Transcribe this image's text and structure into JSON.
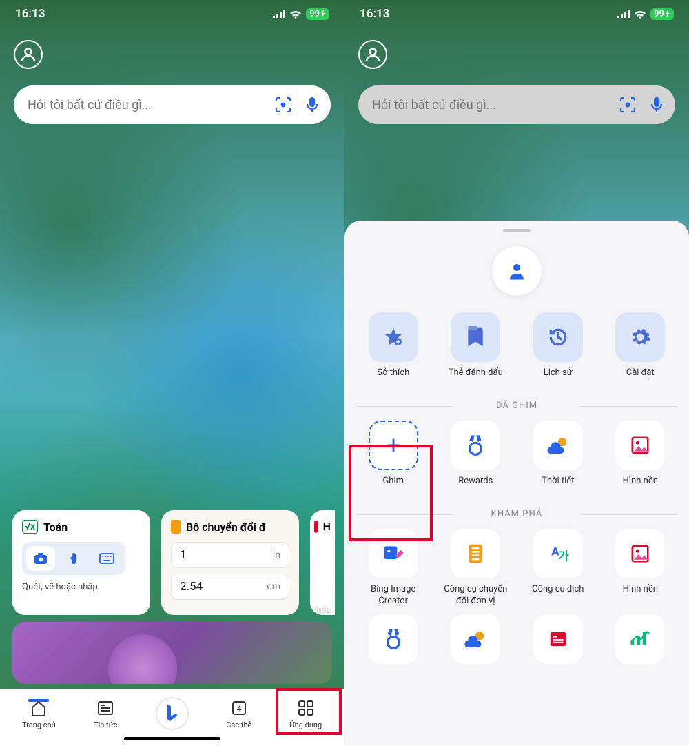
{
  "status": {
    "time": "16:13",
    "battery": "99"
  },
  "search": {
    "placeholder": "Hỏi tôi bất cứ điều gì..."
  },
  "widgets": {
    "math": {
      "title": "Toán",
      "hint": "Quét, vẽ hoặc nhập"
    },
    "converter": {
      "title": "Bộ chuyển đổi đ",
      "val1": "1",
      "unit1": "in",
      "val2": "2.54",
      "unit2": "cm"
    },
    "partial": {
      "title": "H"
    }
  },
  "info_label": "Info",
  "nav": {
    "home": "Trang chủ",
    "news": "Tin tức",
    "tabs": "Các thẻ",
    "tabs_count": "4",
    "apps": "Ứng dụng"
  },
  "sheet": {
    "quick": [
      {
        "label": "Sở thích",
        "icon": "star"
      },
      {
        "label": "Thẻ đánh dấu",
        "icon": "bookmark"
      },
      {
        "label": "Lịch sử",
        "icon": "history"
      },
      {
        "label": "Cài đặt",
        "icon": "gear"
      }
    ],
    "section_pinned": "ĐÃ GHIM",
    "pinned": [
      {
        "label": "Ghim",
        "icon": "plus"
      },
      {
        "label": "Rewards",
        "icon": "medal"
      },
      {
        "label": "Thời tiết",
        "icon": "weather"
      },
      {
        "label": "Hình nền",
        "icon": "wallpaper"
      }
    ],
    "section_explore": "KHÁM PHÁ",
    "explore": [
      {
        "label": "Bing Image Creator",
        "icon": "image-creator"
      },
      {
        "label": "Công cụ chuyển đổi đơn vị",
        "icon": "converter"
      },
      {
        "label": "Công cụ dịch",
        "icon": "translate"
      },
      {
        "label": "Hình nền",
        "icon": "wallpaper"
      }
    ],
    "explore2": [
      {
        "icon": "medal"
      },
      {
        "icon": "weather"
      },
      {
        "icon": "news"
      },
      {
        "icon": "stocks"
      }
    ]
  }
}
